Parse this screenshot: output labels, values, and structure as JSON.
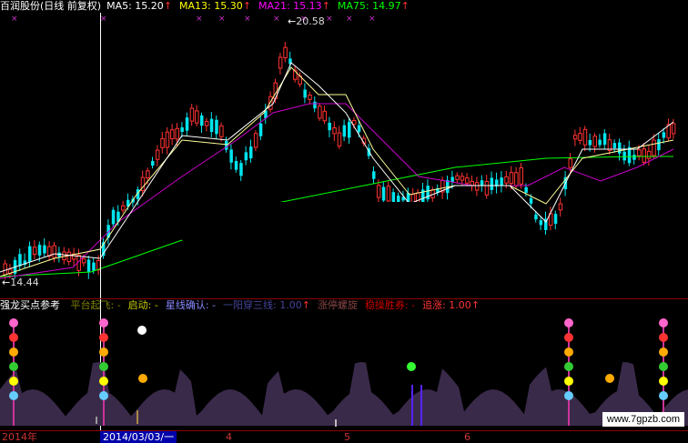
{
  "header": {
    "stock": "百润股份(日线 前复权)",
    "ma5": "MA5: 15.20",
    "ma13": "MA13: 15.30",
    "ma21": "MA21: 15.13",
    "ma75": "MA75: 14.97",
    "up_arrow": "↑",
    "stock_color": "#ffffff",
    "ma5_color": "#ffffff",
    "ma13_color": "#ffff00",
    "ma21_color": "#ff00ff",
    "ma75_color": "#00ff00"
  },
  "price_labels": {
    "high": "20.58",
    "low": "14.44"
  },
  "indicator": {
    "title": "强龙买点参考",
    "items": [
      {
        "label": "平台起飞",
        "suffix": "-",
        "color": "#808000"
      },
      {
        "label": "启动",
        "suffix": "-",
        "color": "#cccc00"
      },
      {
        "label": "星线确认",
        "suffix": "-",
        "color": "#8888ff"
      },
      {
        "label": "一阳穿三线",
        "suffix": "1.00",
        "color": "#444499"
      },
      {
        "label": "涨停螺旋",
        "suffix": "",
        "color": "#884444"
      },
      {
        "label": "稳操胜券",
        "suffix": "-",
        "color": "#cc0000"
      },
      {
        "label": "追涨",
        "suffix": "1.00",
        "color": "#ff3333"
      }
    ]
  },
  "date_axis": {
    "labels": [
      "2014年",
      "2014/03/03/一",
      "4",
      "5",
      "6"
    ]
  },
  "watermark": "www.7gpzb.com",
  "colors": {
    "up": "#ff3232",
    "down": "#00ffff",
    "ma5": "#ffffff",
    "ma13": "#ffff00",
    "ma21": "#ff00ff",
    "ma75": "#00ff00",
    "axis": "#8b0000"
  }
}
